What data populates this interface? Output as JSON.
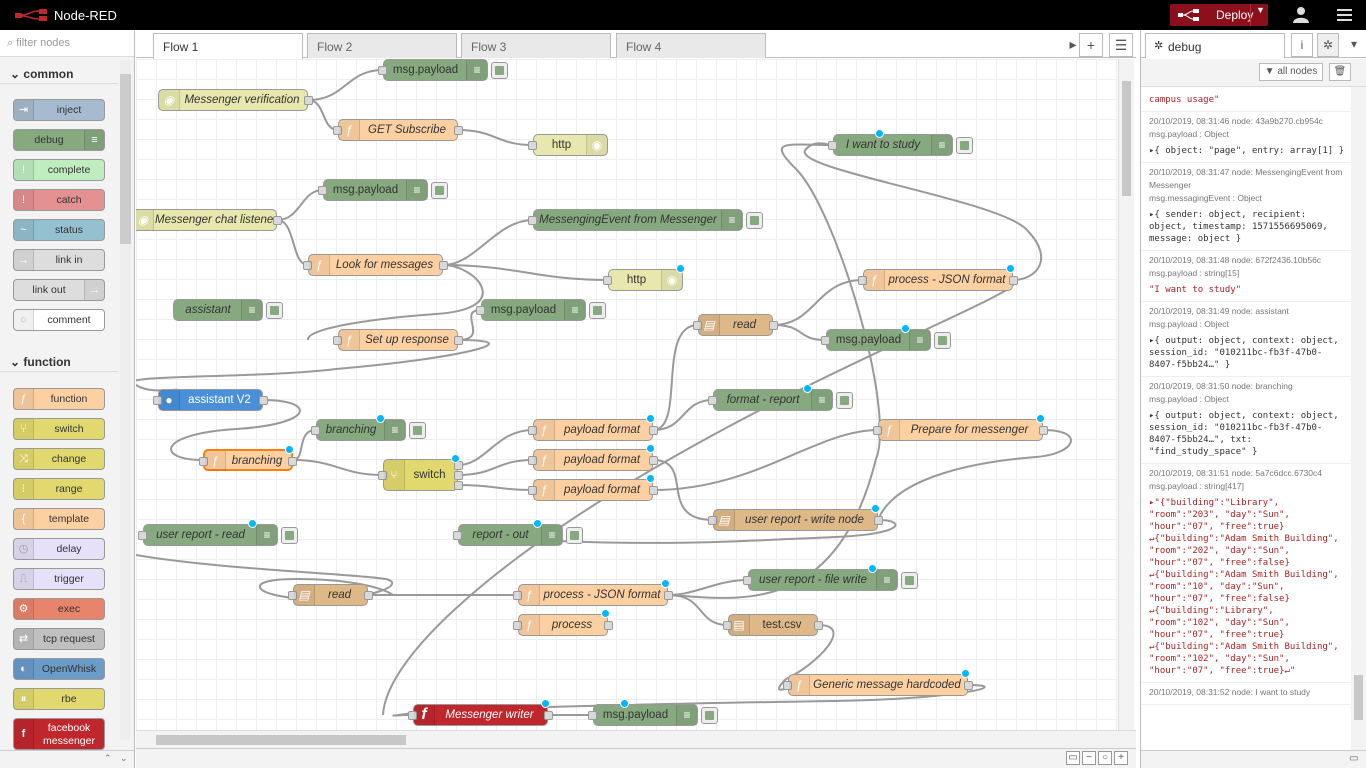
{
  "app": {
    "title": "Node-RED",
    "deploy_label": "Deploy"
  },
  "palette": {
    "search_placeholder": "filter nodes",
    "common_label": "common",
    "function_label": "function",
    "common": [
      "inject",
      "debug",
      "complete",
      "catch",
      "status",
      "link in",
      "link out",
      "comment"
    ],
    "function": [
      "function",
      "switch",
      "change",
      "range",
      "template",
      "delay",
      "trigger",
      "exec",
      "tcp request",
      "OpenWhisk",
      "rbe",
      "facebook messenger"
    ]
  },
  "tabs": [
    "Flow 1",
    "Flow 2",
    "Flow 3",
    "Flow 4"
  ],
  "nodes": {
    "n1": "msg.payload",
    "n2": "Messenger verification",
    "n3": "GET Subscribe",
    "n4": "http",
    "n5": "I want to study",
    "n6": "msg.payload",
    "n7": "Messenger chat listener",
    "n8": "MessengingEvent from Messenger",
    "n9": "Look for messages",
    "n10": "http",
    "n11": "process - JSON format",
    "n12": "assistant",
    "n13": "msg.payload",
    "n14": "Set up response",
    "n15": "read",
    "n16": "msg.payload",
    "n17": "assistant V2",
    "n18": "format - report",
    "n19": "branching",
    "n20": "branching",
    "n21": "switch",
    "n22": "payload format",
    "n23": "payload format",
    "n24": "payload format",
    "n25": "Prepare for messenger",
    "n26": "user report - read",
    "n27": "report - out",
    "n28": "user report - write node",
    "n29": "read",
    "n30": "process - JSON format",
    "n31": "user report - file write",
    "n32": "process",
    "n33": "test.csv",
    "n34": "Generic message hardcoded",
    "n35": "Messenger writer",
    "n36": "msg.payload"
  },
  "sidebar": {
    "tab_label": "debug",
    "filter_label": "all nodes",
    "messages": [
      {
        "head": "",
        "topic": "",
        "value": "campus usage\""
      },
      {
        "head": "20/10/2019, 08:31:46   node: 43a9b270.cb954c",
        "topic": "msg.payload : Object",
        "value": "▸{ object: \"page\", entry: array[1] }"
      },
      {
        "head": "20/10/2019, 08:31:47   node: MessengingEvent from Messenger",
        "topic": "msg.messagingEvent : Object",
        "value": "▸{ sender: object, recipient: object, timestamp: 1571556695069, message: object }"
      },
      {
        "head": "20/10/2019, 08:31:48   node: 672f2436.10b56c",
        "topic": "msg.payload : string[15]",
        "value": "\"I want to study\""
      },
      {
        "head": "20/10/2019, 08:31:49   node: assistant",
        "topic": "msg.payload : Object",
        "value": "▸{ output: object, context: object, session_id: \"010211bc-fb3f-47b0-8407-f5bb24…\" }"
      },
      {
        "head": "20/10/2019, 08:31:50   node: branching",
        "topic": "msg.payload : Object",
        "value": "▸{ output: object, context: object, session_id: \"010211bc-fb3f-47b0-8407-f5bb24…\", txt: \"find_study_space\" }"
      },
      {
        "head": "20/10/2019, 08:31:51   node: 5a7c6dcc.6730c4",
        "topic": "msg.payload : string[417]",
        "value": "▸\"{\"building\":\"Library\", \"room\":\"203\", \"day\":\"Sun\", \"hour\":\"07\", \"free\":true} ↵{\"building\":\"Adam Smith Building\", \"room\":\"202\", \"day\":\"Sun\", \"hour\":\"07\", \"free\":false}↵{\"building\":\"Adam Smith Building\", \"room\":\"10\", \"day\":\"Sun\", \"hour\":\"07\", \"free\":false} ↵{\"building\":\"Library\", \"room\":\"102\", \"day\":\"Sun\", \"hour\":\"07\", \"free\":true} ↵{\"building\":\"Adam Smith Building\", \"room\":\"102\", \"day\":\"Sun\", \"hour\":\"07\", \"free\":true}↵\""
      },
      {
        "head": "20/10/2019, 08:31:52   node: I want to study",
        "topic": "",
        "value": ""
      }
    ]
  },
  "colors": {
    "header": "#000000",
    "deploy": "#8c101c",
    "function_node": "#fdd0a2",
    "debug_node": "#87a980",
    "http_node": "#e7e7ae",
    "switch_node": "#e2d96e",
    "file_node": "#deb887",
    "assistant_node": "#4a90d9",
    "facebook_node": "#c0272d"
  }
}
